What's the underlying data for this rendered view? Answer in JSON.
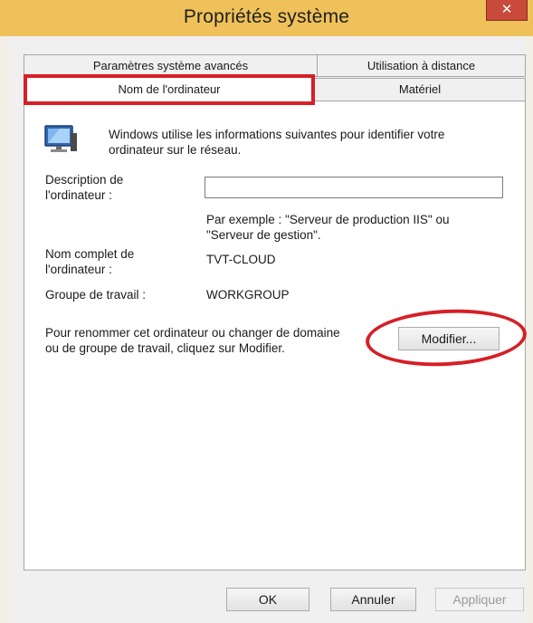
{
  "window": {
    "title": "Propriétés système"
  },
  "tabs": {
    "advanced": "Paramètres système avancés",
    "remote": "Utilisation à distance",
    "computer_name": "Nom de l'ordinateur",
    "hardware": "Matériel"
  },
  "content": {
    "intro_line1": "Windows utilise les informations suivantes pour identifier votre",
    "intro_line2": "ordinateur sur le réseau.",
    "description_label_line1": "Description de",
    "description_label_line2": "l'ordinateur :",
    "description_value": "",
    "example_line1": "Par exemple : \"Serveur de production IIS\" ou",
    "example_line2": "\"Serveur de gestion\".",
    "full_name_label_line1": "Nom complet de",
    "full_name_label_line2": "l'ordinateur :",
    "full_name_value": "TVT-CLOUD",
    "workgroup_label": "Groupe de travail :",
    "workgroup_value": "WORKGROUP",
    "rename_line1": "Pour renommer cet ordinateur ou changer de domaine",
    "rename_line2": "ou de groupe de travail, cliquez sur Modifier.",
    "modify_button": "Modifier..."
  },
  "footer": {
    "ok": "OK",
    "cancel": "Annuler",
    "apply": "Appliquer"
  },
  "colors": {
    "titlebar": "#efc15a",
    "close": "#c74a3b",
    "annotation": "#d61f26"
  },
  "icons": {
    "close": "close-icon",
    "computer": "computer-monitor-icon"
  }
}
